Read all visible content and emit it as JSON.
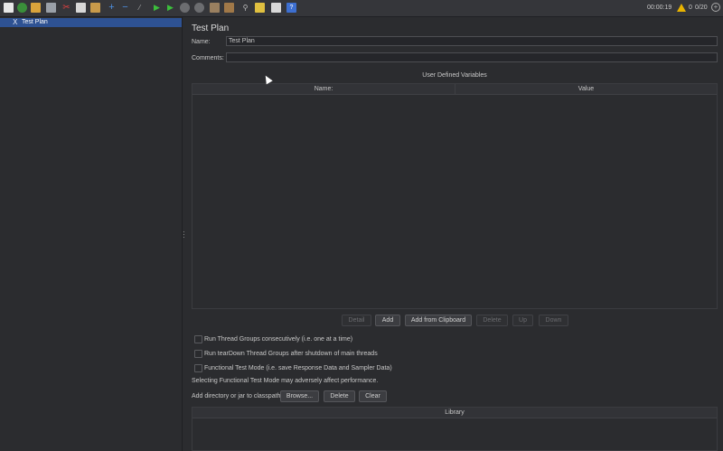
{
  "toolbar": {
    "icons": [
      "new-icon",
      "templates-icon",
      "open-icon",
      "save-icon",
      "cut-icon",
      "copy-icon",
      "paste-icon",
      "expand-icon",
      "collapse-icon",
      "toggle-icon",
      "start-icon",
      "start-no-pause-icon",
      "stop-icon",
      "shutdown-icon",
      "clear-icon",
      "clear-all-icon",
      "search-icon",
      "reset-search-icon",
      "function-helper-icon",
      "help-icon"
    ],
    "timer": "00:00:19",
    "warnings": "0",
    "threads": "0/20"
  },
  "tree": {
    "items": [
      {
        "label": "Test Plan"
      }
    ]
  },
  "panel": {
    "title": "Test Plan",
    "name_label": "Name:",
    "name_value": "Test Plan",
    "comments_label": "Comments:",
    "comments_value": "",
    "udv_title": "User Defined Variables",
    "udv_columns": [
      "Name:",
      "Value"
    ],
    "buttons": {
      "detail": "Detail",
      "add": "Add",
      "add_clipboard": "Add from Clipboard",
      "delete": "Delete",
      "up": "Up",
      "down": "Down"
    },
    "options": [
      "Run Thread Groups consecutively (i.e. one at a time)",
      "Run tearDown Thread Groups after shutdown of main threads",
      "Functional Test Mode (i.e. save Response Data and Sampler Data)"
    ],
    "functional_note": "Selecting Functional Test Mode may adversely affect performance.",
    "classpath_label": "Add directory or jar to classpath",
    "classpath_buttons": {
      "browse": "Browse...",
      "delete": "Delete",
      "clear": "Clear"
    },
    "library_header": "Library"
  }
}
